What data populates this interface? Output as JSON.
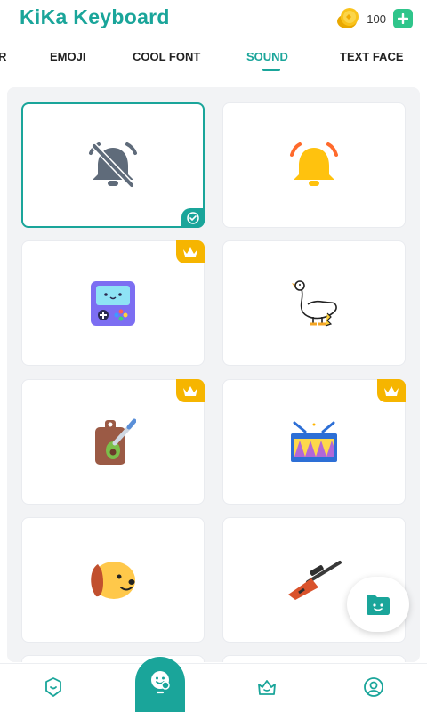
{
  "header": {
    "app_title": "KiKa Keyboard",
    "coin_count": "100",
    "coin_icon": "coin-icon",
    "add_icon": "plus-icon"
  },
  "tabs": [
    {
      "label": "R",
      "active": false
    },
    {
      "label": "EMOJI",
      "active": false
    },
    {
      "label": "COOL FONT",
      "active": false
    },
    {
      "label": "SOUND",
      "active": true
    },
    {
      "label": "TEXT FACE",
      "active": false
    }
  ],
  "sound_cards": [
    {
      "icon": "bell-muted-icon",
      "selected": true,
      "premium": false
    },
    {
      "icon": "bell-ringing-icon",
      "selected": false,
      "premium": false
    },
    {
      "icon": "game-console-icon",
      "selected": false,
      "premium": true
    },
    {
      "icon": "goose-icon",
      "selected": false,
      "premium": false
    },
    {
      "icon": "cutting-board-icon",
      "selected": false,
      "premium": true
    },
    {
      "icon": "drum-icon",
      "selected": false,
      "premium": true
    },
    {
      "icon": "dog-icon",
      "selected": false,
      "premium": false
    },
    {
      "icon": "rifle-icon",
      "selected": false,
      "premium": false
    }
  ],
  "fab": {
    "icon": "sticker-folder-icon"
  },
  "bottom_nav": [
    {
      "icon": "keyboard-theme-icon",
      "active": false
    },
    {
      "icon": "sticker-face-icon",
      "active": true
    },
    {
      "icon": "crown-face-icon",
      "active": false
    },
    {
      "icon": "profile-icon",
      "active": false
    }
  ],
  "colors": {
    "accent": "#1aa59a",
    "premium": "#f6b500",
    "background": "#f2f3f5"
  }
}
